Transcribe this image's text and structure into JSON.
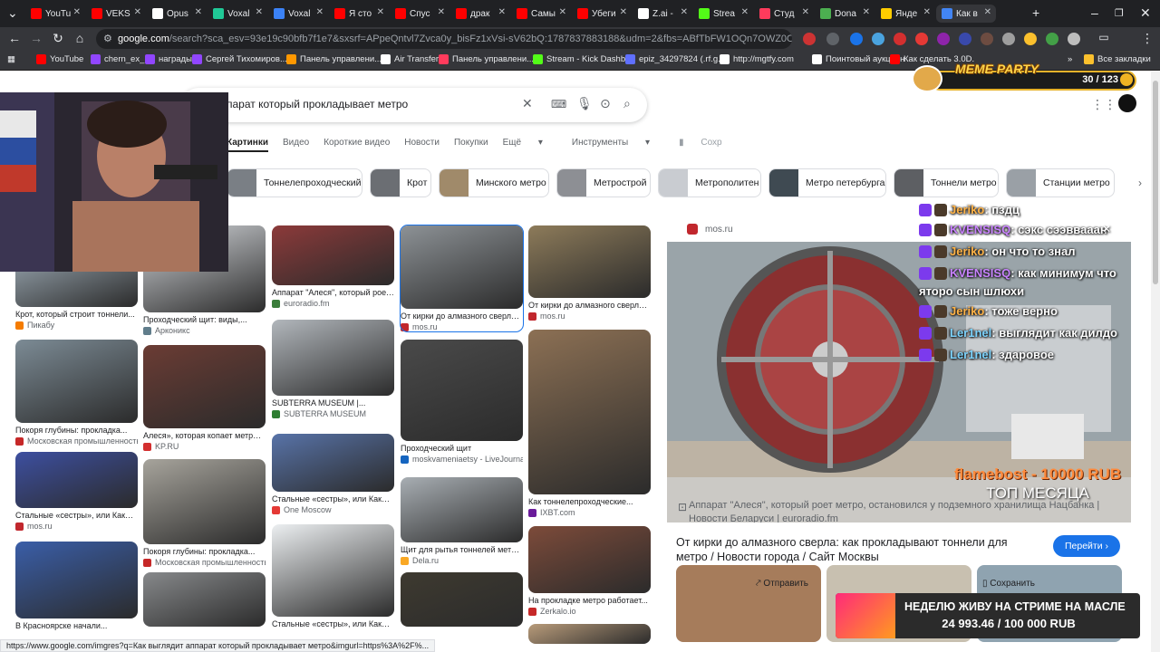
{
  "browser": {
    "tabs": [
      {
        "title": "YouTu",
        "color": "#ff0000"
      },
      {
        "title": "VEKS",
        "color": "#ff0000"
      },
      {
        "title": "Opus",
        "color": "#ffffff"
      },
      {
        "title": "Voxal",
        "color": "#20c997"
      },
      {
        "title": "Voxal",
        "color": "#3b82f6"
      },
      {
        "title": "Я сто",
        "color": "#ff0000"
      },
      {
        "title": "Спус",
        "color": "#ff0000"
      },
      {
        "title": "драк",
        "color": "#ff0000"
      },
      {
        "title": "Самы",
        "color": "#ff0000"
      },
      {
        "title": "Убеги",
        "color": "#ff0000"
      },
      {
        "title": "Z.ai -",
        "color": "#ffffff"
      },
      {
        "title": "Strea",
        "color": "#53fc18"
      },
      {
        "title": "Студ",
        "color": "#ff3b5c"
      },
      {
        "title": "Dona",
        "color": "#4caf50"
      },
      {
        "title": "Янде",
        "color": "#ffcc00"
      },
      {
        "title": "Как в",
        "color": "#4285f4"
      }
    ],
    "url_domain": "google.com",
    "url_path": "/search?sca_esv=93e19c90bfb7f1e7&sxsrf=APpeQntvl7Zvca0y_bisFz1xVsi-sV62bQ:1787837883188&udm=2&fbs=ABfTbFW1OQn7OWZ0OthIF6bH5djPqG2kEan..."
  },
  "bookmarks": [
    {
      "label": "YouTube",
      "color": "#ff0000"
    },
    {
      "label": "chern_ex_",
      "color": "#9146ff"
    },
    {
      "label": "награды",
      "color": "#9146ff"
    },
    {
      "label": "Сергей Тихомиров...",
      "color": "#9146ff"
    },
    {
      "label": "Панель управлени...",
      "color": "#ff9800"
    },
    {
      "label": "Air Transfer",
      "color": "#ffffff"
    },
    {
      "label": "Панель управлени...",
      "color": "#ff3b5c"
    },
    {
      "label": "Stream - Kick Dashb...",
      "color": "#53fc18"
    },
    {
      "label": "epiz_34297824 (.rf.g...",
      "color": "#5f6fff"
    },
    {
      "label": "http://mgtfy.com",
      "color": "#ffffff"
    },
    {
      "label": "Поинтовый аукцион",
      "color": "#ffffff"
    },
    {
      "label": "Как сделать 3.0D.",
      "color": "#ff0000"
    }
  ],
  "bookmarks_more": "Все закладки",
  "search": {
    "query": "парат который прокладывает метро"
  },
  "nav_tabs": [
    "Картинки",
    "Видео",
    "Короткие видео",
    "Новости",
    "Покупки",
    "Ещё",
    "Инструменты",
    "Сохр"
  ],
  "chips": [
    {
      "label": "Тоннелепроходческий щит",
      "color": "#7a7f85"
    },
    {
      "label": "Крот",
      "color": "#6b6e73"
    },
    {
      "label": "Минского метро",
      "color": "#a08a6a"
    },
    {
      "label": "Метрострой",
      "color": "#8d8f94"
    },
    {
      "label": "Метрополитен",
      "color": "#c9ccd1"
    },
    {
      "label": "Метро петербурга",
      "color": "#3f4a52"
    },
    {
      "label": "Тоннели метро",
      "color": "#5d5f63"
    },
    {
      "label": "Станции метро",
      "color": "#9aa0a6"
    }
  ],
  "results": {
    "col1": [
      {
        "caption": "Крот, который строит тоннели...",
        "source": "Пикабу",
        "src_color": "#f57c00",
        "img": "#8e9aa3"
      },
      {
        "caption": "Покоря глубины: прокладка...",
        "source": "Московская промышленность",
        "src_color": "#c62828",
        "img": "#7c8b95"
      },
      {
        "caption": "Стальные «сестры», или Какие...",
        "source": "mos.ru",
        "src_color": "#c1272d",
        "img": "#3d4fa0"
      },
      {
        "caption": "В Красноярске начали...",
        "source": "",
        "src_color": "#ffffff",
        "img": "#3a5ea8"
      }
    ],
    "col2": [
      {
        "caption": "Проходческий щит: виды,...",
        "source": "Арконикс",
        "src_color": "#607d8b",
        "img": "#d5d8dc"
      },
      {
        "caption": "Алеся», которая копает метро,...",
        "source": "KP.RU",
        "src_color": "#d32f2f",
        "img": "#6b3c34"
      },
      {
        "caption": "Покоря глубины: прокладка...",
        "source": "Московская промышленность",
        "src_color": "#c62828",
        "img": "#a7a49c"
      },
      {
        "caption": "",
        "source": "",
        "src_color": "#ffffff",
        "img": "#87898b"
      }
    ],
    "col3": [
      {
        "caption": "Аппарат \"Алеся\", который роет...",
        "source": "euroradio.fm",
        "src_color": "#3b7d3b",
        "img": "#8c3a3a"
      },
      {
        "caption": "SUBTERRA MUSEUM |...",
        "source": "SUBTERRA MUSEUM",
        "src_color": "#2e7d32",
        "img": "#b2b7bc"
      },
      {
        "caption": "Стальные «сестры», или Какие...",
        "source": "One Moscow",
        "src_color": "#e53935",
        "img": "#5873a8"
      },
      {
        "caption": "Стальные «сестры», или Какие...",
        "source": "",
        "src_color": "#ffffff",
        "img": "#eceff1"
      }
    ],
    "col4": [
      {
        "caption": "От кирки до алмазного сверла:...",
        "source": "mos.ru",
        "src_color": "#c1272d",
        "img": "#8d9296"
      },
      {
        "caption": "Проходческий щит",
        "source": "moskvameniaetsy - LiveJournal",
        "src_color": "#1565c0",
        "img": "#4a4a4a"
      },
      {
        "caption": "Щит для рытья тоннелей метро...",
        "source": "Dela.ru",
        "src_color": "#f9a825",
        "img": "#a8aeb3"
      },
      {
        "caption": "",
        "source": "",
        "src_color": "#ffffff",
        "img": "#3e3a30"
      }
    ],
    "col5": [
      {
        "caption": "От кирки до алмазного сверла:...",
        "source": "mos.ru",
        "src_color": "#c1272d",
        "img": "#8d7b5a"
      },
      {
        "caption": "Как тоннелепроходческие...",
        "source": "IXBT.com",
        "src_color": "#6a1b9a",
        "img": "#8c7054"
      },
      {
        "caption": "На прокладке метро работает...",
        "source": "Zerkalo.io",
        "src_color": "#c62828",
        "img": "#7d4b3a"
      },
      {
        "caption": "",
        "source": "",
        "src_color": "#ffffff",
        "img": "#b89b7a"
      }
    ]
  },
  "preview": {
    "source": "mos.ru",
    "title": "От кирки до алмазного сверла: как прокладывают тоннели для метро / Новости города / Сайт Москвы",
    "visit_label": "Перейти",
    "overlay_caption": "Аппарат \"Алеся\", который роет метро, остановился у подземного хранилища Нацбанка | Новости Беларуси | euroradio.fm",
    "share_label": "Отправить",
    "save_label": "Сохранить",
    "image_color": "#7f8b90"
  },
  "status_url": "https://www.google.com/imgres?q=Как выглядит аппарат который прокладывает метро&imgurl=https%3A%2F%...",
  "overlay": {
    "meme_title": "MEME PARTY",
    "meme_count": "30 / 123",
    "chat": [
      {
        "nick": "Jeriko",
        "text": "пздц",
        "nick_color": "#ffb347"
      },
      {
        "nick": "KVENSISQ",
        "text": "сэкс сээввааан",
        "nick_color": "#c983ff"
      },
      {
        "nick": "Jeriko",
        "text": "он что то знал",
        "nick_color": "#ffb347"
      },
      {
        "nick": "KVENSISQ",
        "text": "как минимум что",
        "nick_color": "#c983ff"
      },
      {
        "nick": "",
        "text": "яторо сын шлюхи",
        "nick_color": "#ffffff"
      },
      {
        "nick": "Jeriko",
        "text": "тоже верно",
        "nick_color": "#ffb347"
      },
      {
        "nick": "Ler1nel",
        "text": "выглядит как дилдо",
        "nick_color": "#7dd3fc"
      },
      {
        "nick": "Ler1nel",
        "text": "здаровое",
        "nick_color": "#7dd3fc"
      }
    ],
    "donation_name": "flamebost - 10000 RUB",
    "donation_sub": "ТОП МЕСЯЦА",
    "goal_title": "НЕДЕЛЮ ЖИВУ НА СТРИМЕ НА МАСЛЕ",
    "goal_value": "24 993.46 / 100 000 RUB"
  }
}
